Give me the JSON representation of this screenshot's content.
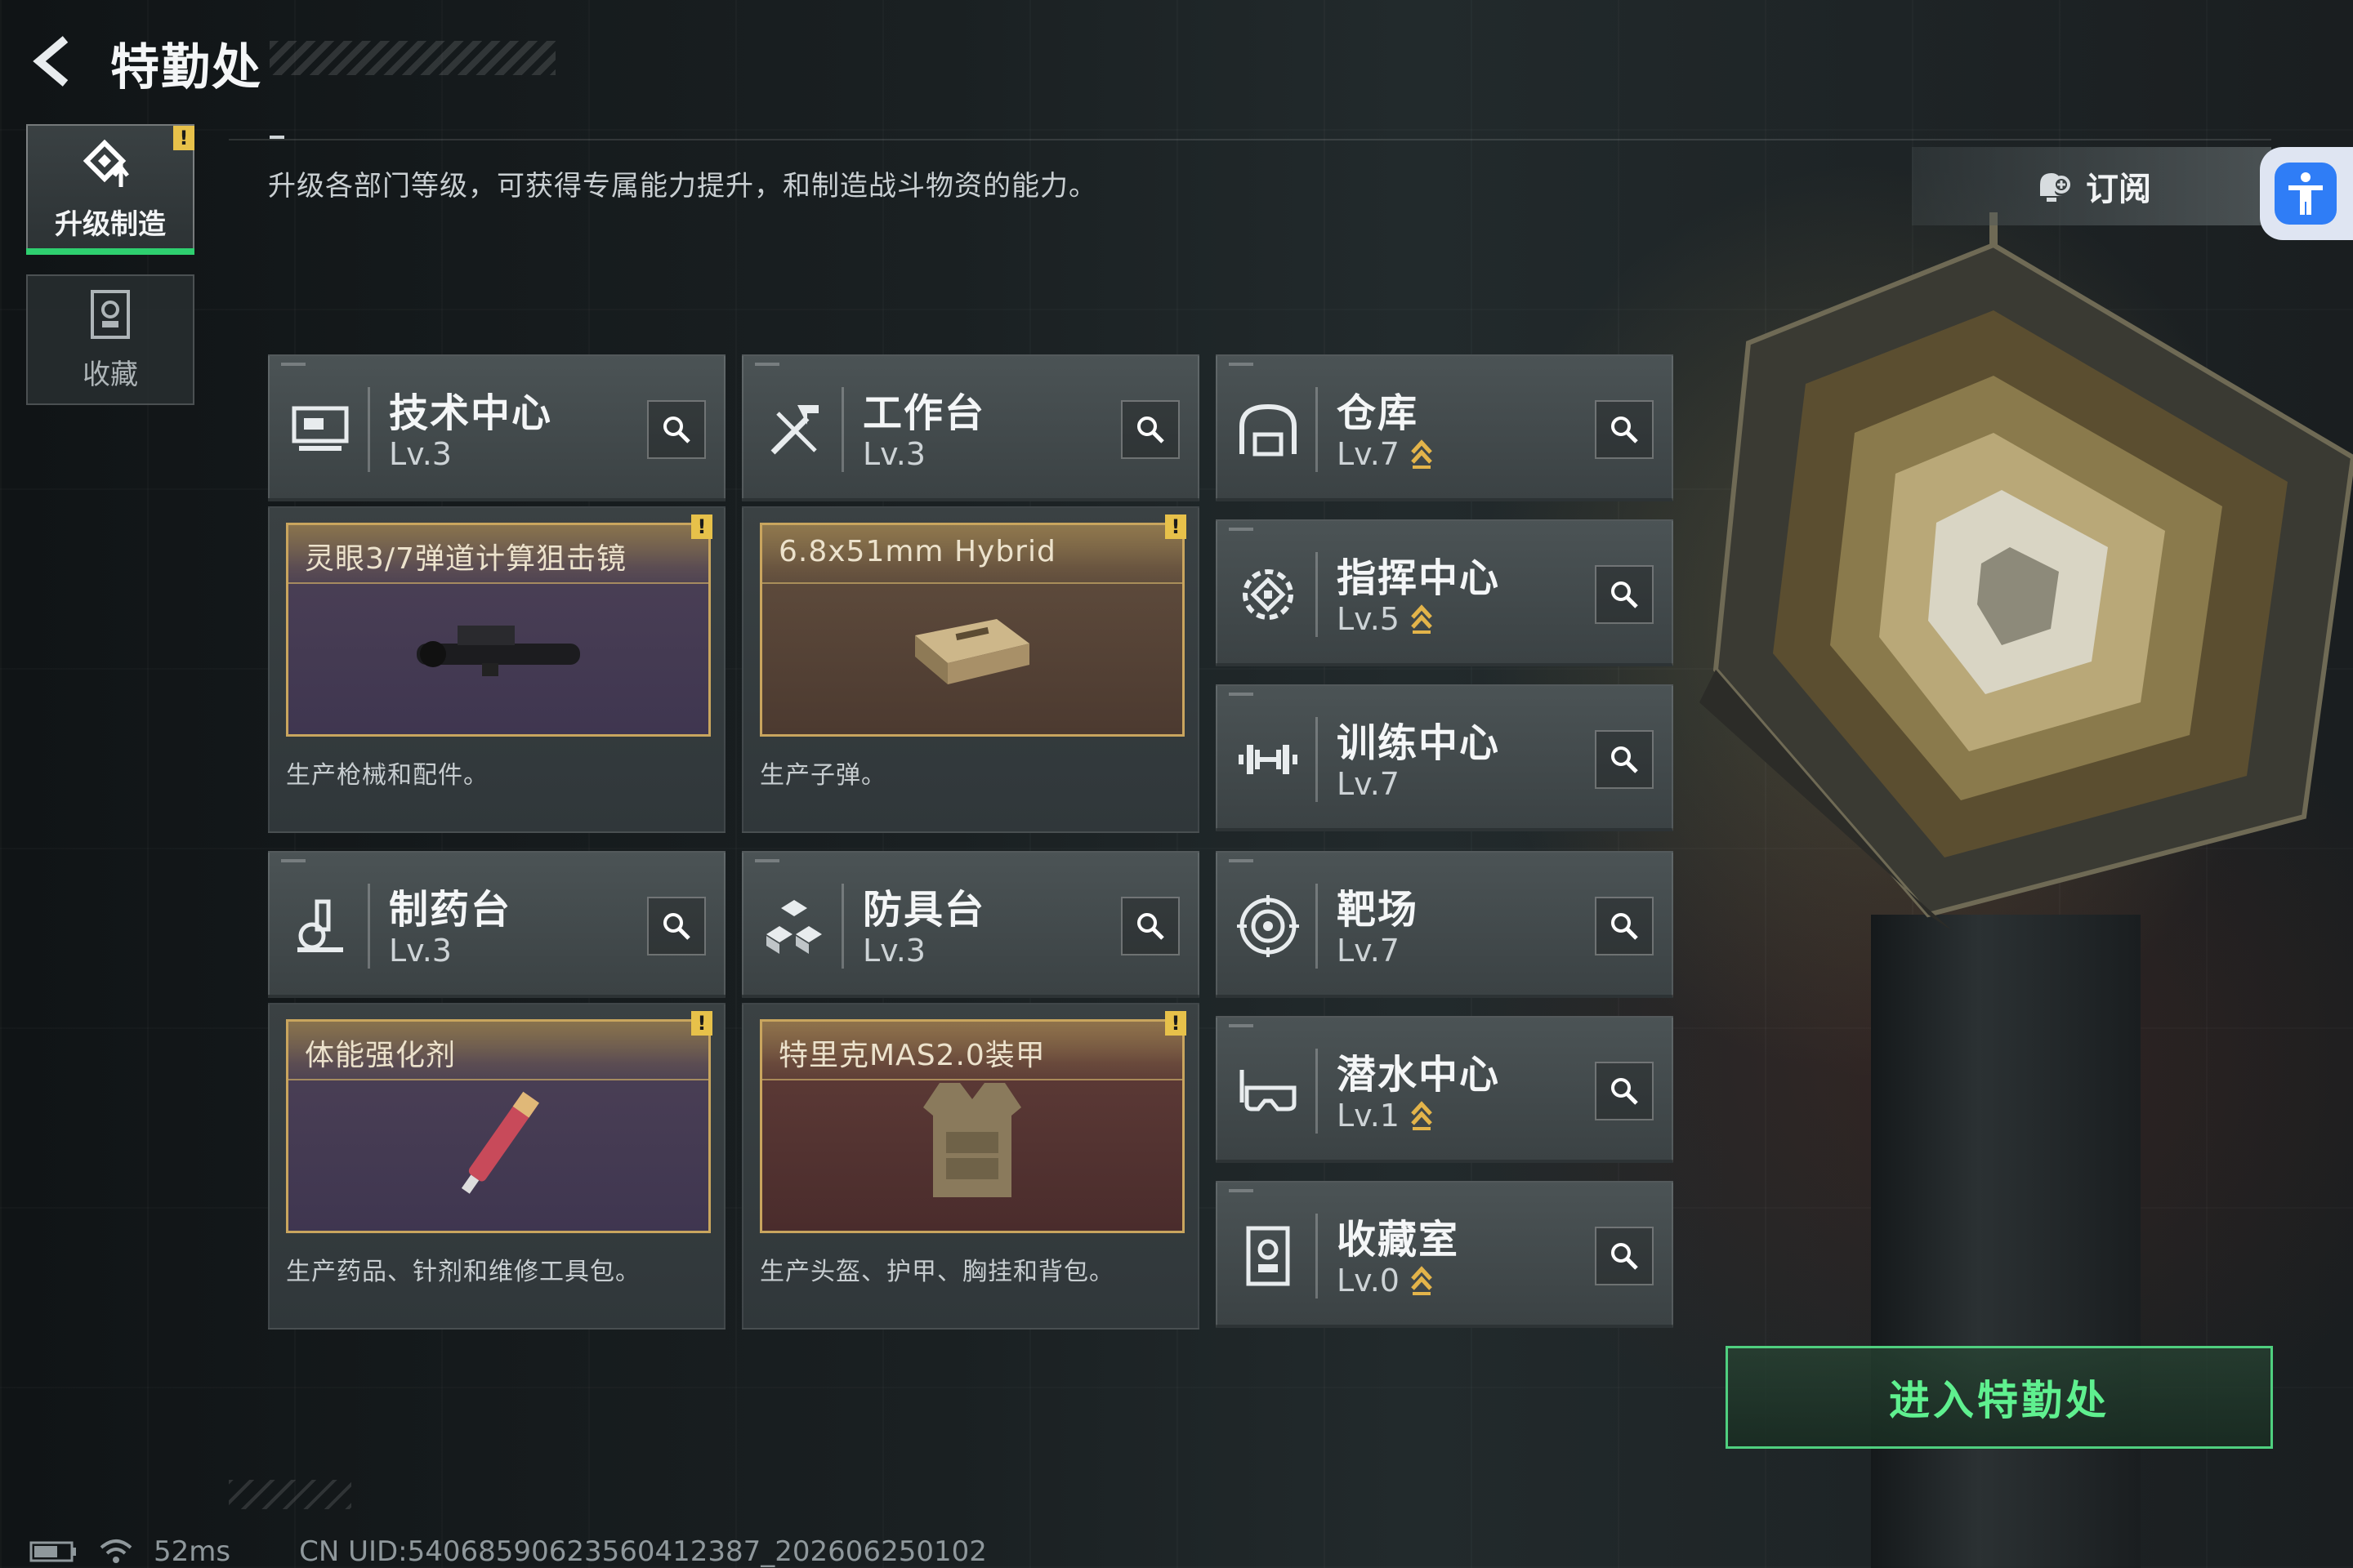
{
  "header": {
    "title": "特勤处"
  },
  "description": "升级各部门等级，可获得专属能力提升，和制造战斗物资的能力。",
  "sidebar": {
    "tabs": [
      {
        "label": "升级制造",
        "active": true,
        "icon": "upgrade-icon"
      },
      {
        "label": "收藏",
        "active": false,
        "icon": "collection-icon"
      }
    ]
  },
  "subscribe_label": "订阅",
  "departments": [
    {
      "name": "技术中心",
      "level": "Lv.3",
      "upgradable": false,
      "icon": "monitor-icon"
    },
    {
      "name": "工作台",
      "level": "Lv.3",
      "upgradable": false,
      "icon": "tools-icon"
    },
    {
      "name": "仓库",
      "level": "Lv.7",
      "upgradable": true,
      "icon": "warehouse-icon"
    },
    {
      "name": "指挥中心",
      "level": "Lv.5",
      "upgradable": true,
      "icon": "command-icon"
    },
    {
      "name": "训练中心",
      "level": "Lv.7",
      "upgradable": false,
      "icon": "dumbbell-icon"
    },
    {
      "name": "制药台",
      "level": "Lv.3",
      "upgradable": false,
      "icon": "microscope-icon"
    },
    {
      "name": "防具台",
      "level": "Lv.3",
      "upgradable": false,
      "icon": "blocks-icon"
    },
    {
      "name": "靶场",
      "level": "Lv.7",
      "upgradable": false,
      "icon": "target-icon"
    },
    {
      "name": "潜水中心",
      "level": "Lv.1",
      "upgradable": true,
      "icon": "diving-mask-icon"
    },
    {
      "name": "收藏室",
      "level": "Lv.0",
      "upgradable": true,
      "icon": "trophy-room-icon"
    }
  ],
  "productions": [
    {
      "item": "灵眼3/7弹道计算狙击镜",
      "desc": "生产枪械和配件。",
      "alert": "!"
    },
    {
      "item": "6.8x51mm Hybrid",
      "desc": "生产子弹。",
      "alert": "!"
    },
    {
      "item": "体能强化剂",
      "desc": "生产药品、针剂和维修工具包。",
      "alert": "!"
    },
    {
      "item": "特里克MAS2.0装甲",
      "desc": "生产头盔、护甲、胸挂和背包。",
      "alert": "!"
    }
  ],
  "enter_label": "进入特勤处",
  "status": {
    "ping": "52ms",
    "uid": "CN UID:5406859062356041238​7_202606250102"
  },
  "colors": {
    "accent_green": "#4fcf7f",
    "warning_yellow": "#e7c14a",
    "gold_frame": "#c9a55e",
    "access_blue": "#2f7df6"
  }
}
